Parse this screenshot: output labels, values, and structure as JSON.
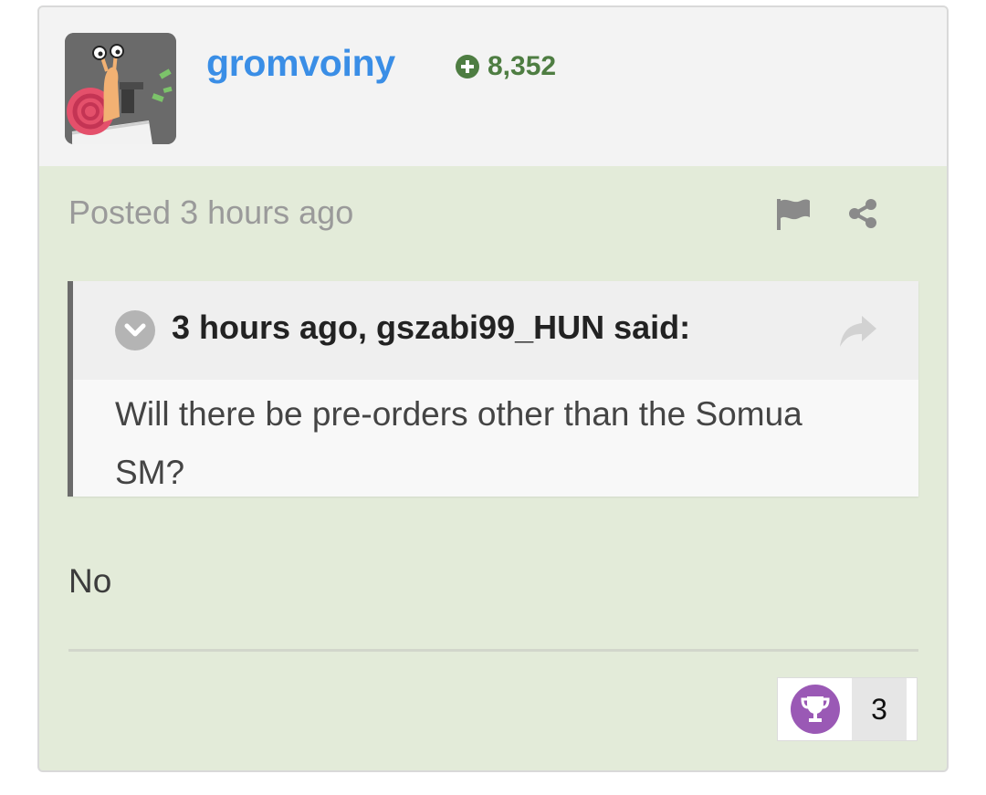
{
  "post": {
    "author": {
      "username": "gromvoiny",
      "reputation": "8,352",
      "avatar_icon": "snail-avatar"
    },
    "posted_time": "Posted 3 hours ago",
    "actions": {
      "report_icon": "flag-icon",
      "share_icon": "share-icon"
    },
    "quote": {
      "header": "3 hours ago, gszabi99_HUN said:",
      "body": "Will there be pre-orders other than the Somua SM?",
      "toggle_icon": "chevron-down-icon",
      "link_icon": "share-arrow-icon"
    },
    "reply": "No",
    "reactions": {
      "icon": "trophy-icon",
      "count": "3",
      "color": "#9a59b5"
    }
  },
  "colors": {
    "accent_username": "#3a8ee6",
    "reputation_green": "#4e7d42",
    "post_background": "#e3ebd9",
    "header_background": "#f3f3f3"
  }
}
